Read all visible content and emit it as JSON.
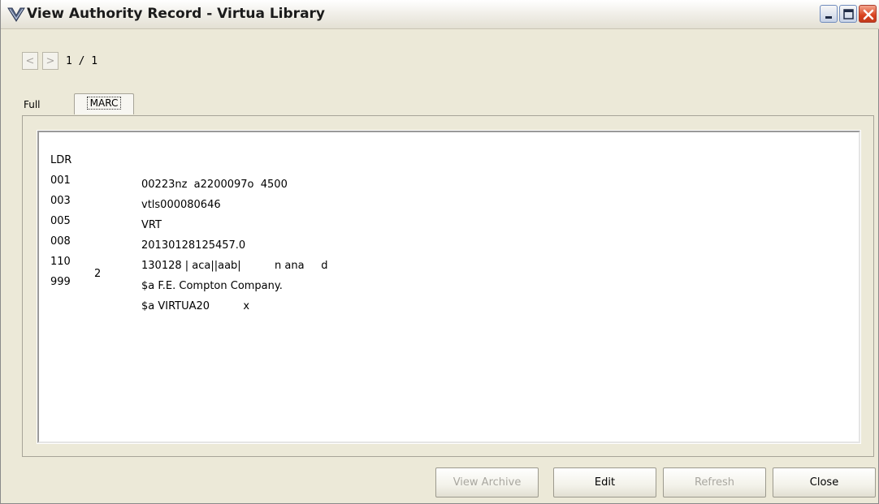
{
  "window": {
    "title": "View Authority Record - Virtua Library"
  },
  "nav": {
    "prev_label": "<",
    "next_label": ">",
    "page_indicator": "1 / 1"
  },
  "tabs": [
    {
      "label": "Full"
    },
    {
      "label": "MARC",
      "active": true
    }
  ],
  "marc_record": [
    {
      "tag": "LDR",
      "ind": "",
      "value": "00223nz  a2200097o  4500"
    },
    {
      "tag": "001",
      "ind": "",
      "value": "vtls000080646"
    },
    {
      "tag": "003",
      "ind": "",
      "value": "VRT"
    },
    {
      "tag": "005",
      "ind": "",
      "value": "20130128125457.0"
    },
    {
      "tag": "008",
      "ind": "",
      "value": "130128 | aca||aab|          n ana     d"
    },
    {
      "tag": "110",
      "ind": "2",
      "value": "$a F.E. Compton Company."
    },
    {
      "tag": "999",
      "ind": "",
      "value": "$a VIRTUA20          x"
    }
  ],
  "buttons": {
    "view_archive": "View Archive",
    "edit": "Edit",
    "refresh": "Refresh",
    "close": "Close"
  },
  "colors": {
    "window_bg": "#ece9d8",
    "close_button": "#d8421e",
    "disabled_text": "#a9a7a0"
  },
  "icons": {
    "app": "virtua-v-logo-icon",
    "minimize": "minimize-icon",
    "maximize": "maximize-icon",
    "close": "close-icon"
  }
}
